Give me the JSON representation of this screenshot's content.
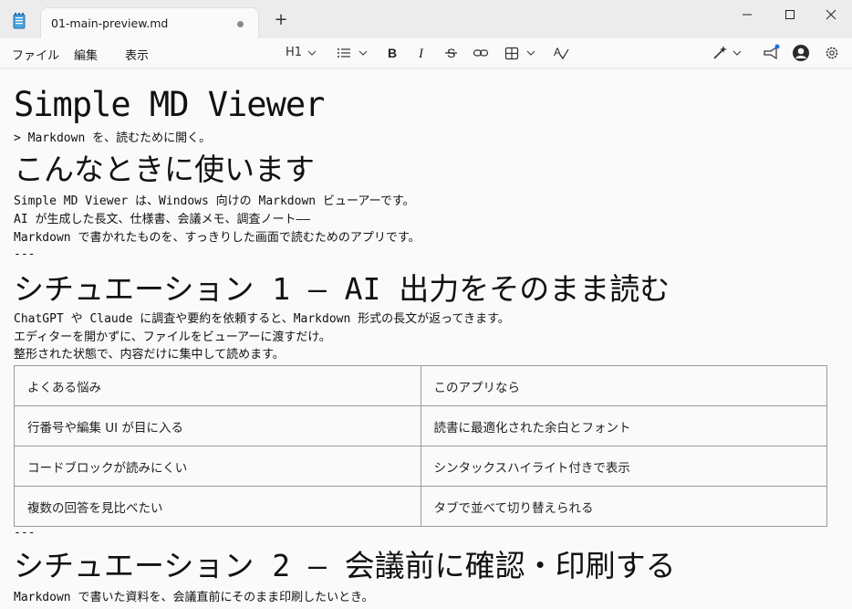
{
  "window": {
    "tab_title": "01-main-preview.md",
    "new_tab_label": "+"
  },
  "menu": {
    "file": "ファイル",
    "edit": "編集",
    "view": "表示"
  },
  "toolbar": {
    "heading_level": "H1"
  },
  "document": {
    "title": "Simple MD Viewer",
    "tagline": "> Markdown を、読むために開く。",
    "section1_heading": "こんなときに使います",
    "section1_lines": [
      "Simple MD Viewer は、Windows 向けの Markdown ビューアーです。",
      "AI が生成した長文、仕様書、会議メモ、調査ノート——",
      "Markdown で書かれたものを、すっきりした画面で読むためのアプリです。"
    ],
    "rule1": "---",
    "section2_heading": "シチュエーション 1 — AI 出力をそのまま読む",
    "section2_lines": [
      "ChatGPT や Claude に調査や要約を依頼すると、Markdown 形式の長文が返ってきます。",
      "エディターを開かずに、ファイルをビューアーに渡すだけ。",
      "整形された状態で、内容だけに集中して読めます。"
    ],
    "table": {
      "rows": [
        [
          "よくある悩み",
          "このアプリなら"
        ],
        [
          "行番号や編集 UI が目に入る",
          "読書に最適化された余白とフォント"
        ],
        [
          "コードブロックが読みにくい",
          "シンタックスハイライト付きで表示"
        ],
        [
          "複数の回答を見比べたい",
          "タブで並べて切り替えられる"
        ]
      ]
    },
    "rule2": "---",
    "section3_heading": "シチュエーション 2 — 会議前に確認・印刷する",
    "section3_lines": [
      "Markdown で書いた資料を、会議直前にそのまま印刷したいとき。"
    ]
  }
}
